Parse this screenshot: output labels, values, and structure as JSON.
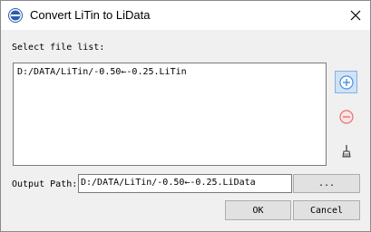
{
  "window": {
    "title": "Convert LiTin to LiData",
    "logo_icon": "app-logo-icon",
    "close_icon": "close-icon"
  },
  "file_list": {
    "label": "Select file list:",
    "items": [
      "D:/DATA/LiTin/-0.50←-0.25.LiTin"
    ]
  },
  "side_buttons": {
    "add_icon": "plus-circle-icon",
    "remove_icon": "minus-circle-icon",
    "clear_icon": "broom-icon"
  },
  "output": {
    "label": "Output Path:",
    "value": "D:/DATA/LiTin/-0.50←-0.25.LiData",
    "browse_label": "..."
  },
  "actions": {
    "ok_label": "OK",
    "cancel_label": "Cancel"
  },
  "colors": {
    "add_button_bg": "#cfe2f6",
    "add_icon_color": "#4a90e2",
    "remove_icon_color": "#e57373"
  }
}
